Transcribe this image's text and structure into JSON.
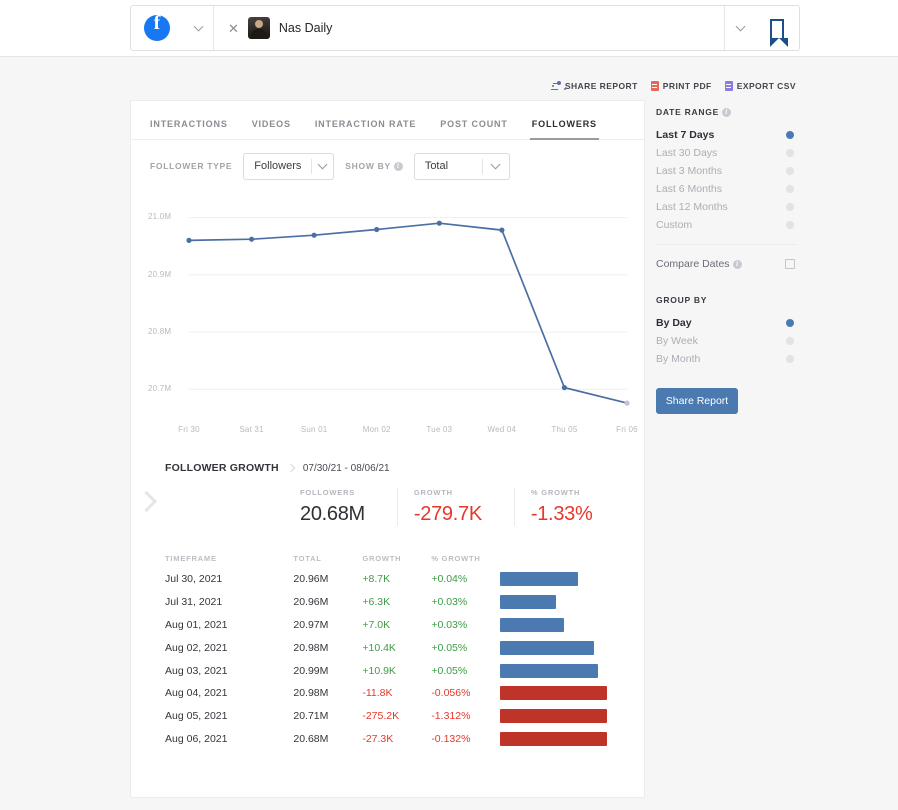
{
  "header": {
    "platform_icon": "facebook-logo",
    "chip_close": "✕",
    "profile_name": "Nas Daily",
    "bookmark_icon": "bookmark-icon"
  },
  "report_actions": [
    {
      "label": "SHARE REPORT",
      "icon": "share-icon"
    },
    {
      "label": "PRINT PDF",
      "icon": "pdf-document-icon",
      "color": "#e8675a"
    },
    {
      "label": "EXPORT CSV",
      "icon": "csv-document-icon",
      "color": "#8a7de0"
    }
  ],
  "tabs": [
    {
      "label": "INTERACTIONS",
      "active": false
    },
    {
      "label": "VIDEOS",
      "active": false
    },
    {
      "label": "INTERACTION RATE",
      "active": false
    },
    {
      "label": "POST COUNT",
      "active": false
    },
    {
      "label": "FOLLOWERS",
      "active": true
    }
  ],
  "filters": {
    "follower_type_label": "FOLLOWER TYPE",
    "follower_type_value": "Followers",
    "show_by_label": "SHOW BY",
    "show_by_value": "Total"
  },
  "chart_data": {
    "type": "line",
    "title": "",
    "xlabel": "",
    "ylabel": "",
    "x": [
      "Fri 30",
      "Sat 31",
      "Sun 01",
      "Mon 02",
      "Tue 03",
      "Wed 04",
      "Thu 05",
      "Fri 06"
    ],
    "values": [
      20960000,
      20962000,
      20969000,
      20979000,
      20990000,
      20978000,
      20703000,
      20676000
    ],
    "ytick_labels": [
      "21.0M",
      "20.9M",
      "20.8M",
      "20.7M"
    ],
    "ytick_values": [
      21000000,
      20900000,
      20800000,
      20700000
    ],
    "ylim": [
      20650000,
      21020000
    ],
    "grid": true,
    "legend": "none",
    "line_color": "#4a6fa5",
    "marker_color": "#4a6fa5",
    "last_marker_color": "#c3c3cb"
  },
  "growth": {
    "section_title": "FOLLOWER GROWTH",
    "date_range": "07/30/21 - 08/06/21",
    "summary": [
      {
        "label": "FOLLOWERS",
        "value": "20.68M",
        "negative": false
      },
      {
        "label": "GROWTH",
        "value": "-279.7K",
        "negative": true
      },
      {
        "label": "% GROWTH",
        "value": "-1.33%",
        "negative": true
      }
    ],
    "columns": [
      "TIMEFRAME",
      "TOTAL",
      "GROWTH",
      "% GROWTH"
    ],
    "rows": [
      {
        "timeframe": "Jul 30, 2021",
        "total": "20.96M",
        "growth": "+8.7K",
        "pct": "+0.04%",
        "dir": "up",
        "bar": 54
      },
      {
        "timeframe": "Jul 31, 2021",
        "total": "20.96M",
        "growth": "+6.3K",
        "pct": "+0.03%",
        "dir": "up",
        "bar": 39
      },
      {
        "timeframe": "Aug 01, 2021",
        "total": "20.97M",
        "growth": "+7.0K",
        "pct": "+0.03%",
        "dir": "up",
        "bar": 44
      },
      {
        "timeframe": "Aug 02, 2021",
        "total": "20.98M",
        "growth": "+10.4K",
        "pct": "+0.05%",
        "dir": "up",
        "bar": 65
      },
      {
        "timeframe": "Aug 03, 2021",
        "total": "20.99M",
        "growth": "+10.9K",
        "pct": "+0.05%",
        "dir": "up",
        "bar": 68
      },
      {
        "timeframe": "Aug 04, 2021",
        "total": "20.98M",
        "growth": "-11.8K",
        "pct": "-0.056%",
        "dir": "down",
        "bar": 74
      },
      {
        "timeframe": "Aug 05, 2021",
        "total": "20.71M",
        "growth": "-275.2K",
        "pct": "-1.312%",
        "dir": "down",
        "bar": 74
      },
      {
        "timeframe": "Aug 06, 2021",
        "total": "20.68M",
        "growth": "-27.3K",
        "pct": "-0.132%",
        "dir": "down",
        "bar": 74
      }
    ]
  },
  "sidebar": {
    "date_range_title": "DATE RANGE",
    "date_range_options": [
      {
        "label": "Last 7 Days",
        "selected": true
      },
      {
        "label": "Last 30 Days",
        "selected": false
      },
      {
        "label": "Last 3 Months",
        "selected": false
      },
      {
        "label": "Last 6 Months",
        "selected": false
      },
      {
        "label": "Last 12 Months",
        "selected": false
      },
      {
        "label": "Custom",
        "selected": false
      }
    ],
    "compare_dates_label": "Compare Dates",
    "compare_dates_checked": false,
    "group_by_title": "GROUP BY",
    "group_by_options": [
      {
        "label": "By Day",
        "selected": true
      },
      {
        "label": "By Week",
        "selected": false
      },
      {
        "label": "By Month",
        "selected": false
      }
    ],
    "share_button": "Share Report"
  },
  "colors": {
    "accent": "#4a7ab0",
    "positive": "#3f9b46",
    "negative": "#e8372a",
    "brand": "#1877f2"
  }
}
